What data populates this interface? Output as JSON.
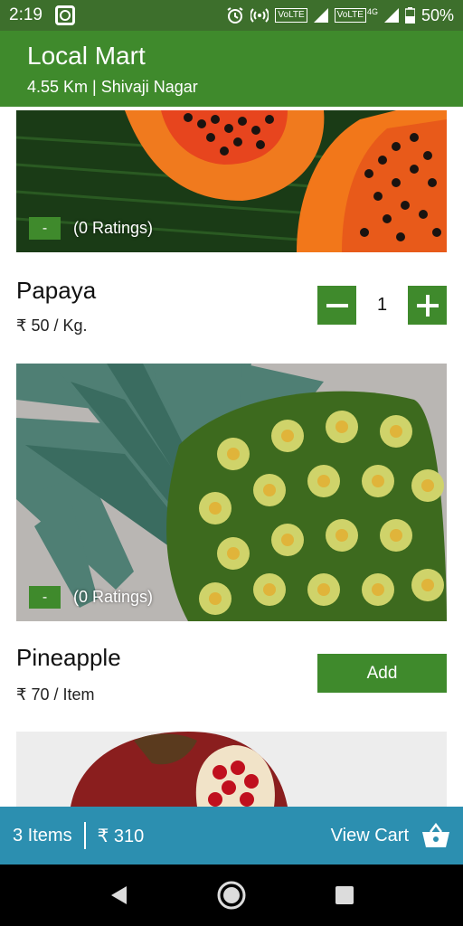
{
  "status_bar": {
    "time": "2:19",
    "tag1": "VoLTE",
    "tag2": "VoLTE",
    "net_label": "4G",
    "battery": "50%"
  },
  "header": {
    "title": "Local Mart",
    "subtitle": "4.55 Km | Shivaji Nagar"
  },
  "products": [
    {
      "name": "Papaya",
      "price": "₹ 50 / Kg.",
      "rating_badge": "-",
      "ratings": "(0 Ratings)",
      "quantity": "1"
    },
    {
      "name": "Pineapple",
      "price": "₹ 70 / Item",
      "rating_badge": "-",
      "ratings": "(0 Ratings)",
      "add_label": "Add"
    }
  ],
  "cart": {
    "items": "3 Items",
    "total": "₹ 310",
    "view_label": "View Cart"
  },
  "colors": {
    "status_bar": "#3d6f2c",
    "header": "#3f8a2c",
    "accent": "#3f8a2c",
    "cart_bar": "#2c8fb0"
  },
  "icons": {
    "minus": "minus-icon",
    "plus": "plus-icon",
    "cart": "basket-icon",
    "back": "back-icon",
    "home": "home-icon",
    "recents": "recents-icon"
  }
}
